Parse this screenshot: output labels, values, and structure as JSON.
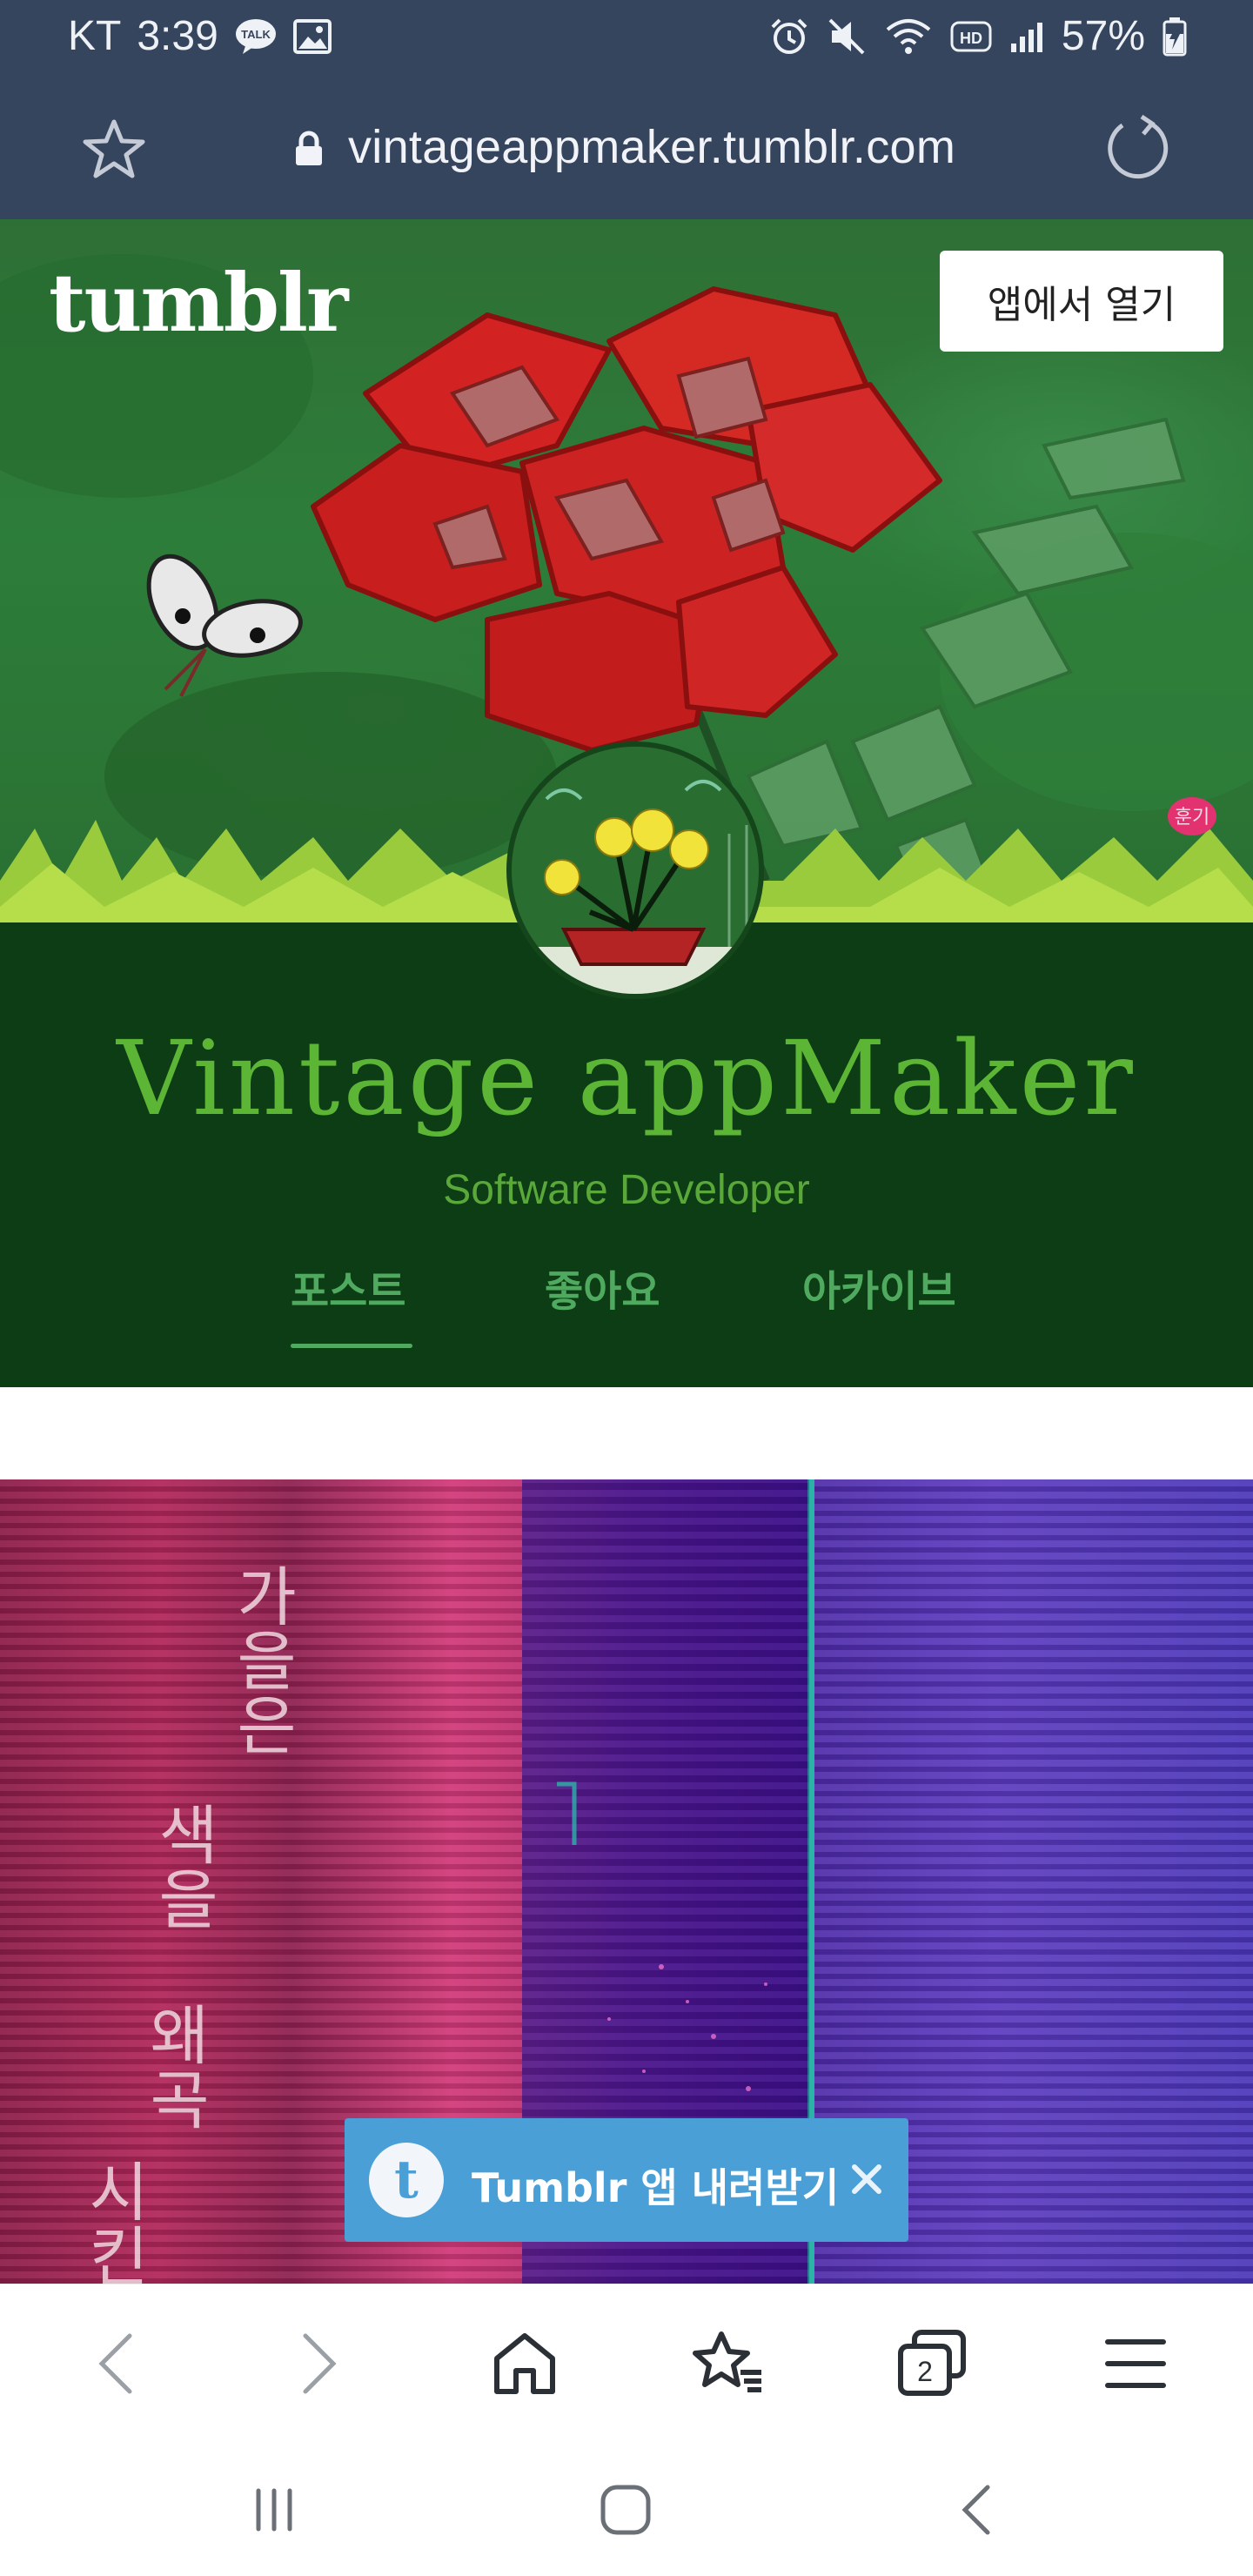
{
  "status_bar": {
    "carrier": "KT",
    "time": "3:39",
    "talk_badge": "TALK",
    "network_badge": "HD",
    "battery": "57%"
  },
  "browser": {
    "url": "vintageappmaker.tumblr.com"
  },
  "header": {
    "logo": "tumblr",
    "open_in_app": "앱에서 열기"
  },
  "blog": {
    "title": "Vintage appMaker",
    "subtitle": "Software Developer",
    "tabs": [
      "포스트",
      "좋아요",
      "아카이브"
    ],
    "active_tab": "포스트"
  },
  "post": {
    "handwritten_text": [
      "가을은",
      "색을",
      "왜곡",
      "시킨다"
    ]
  },
  "toast": {
    "logo": "t",
    "label": "Tumblr 앱 내려받기"
  },
  "toolbar": {
    "tabs_count": "2"
  },
  "colors": {
    "browser_chrome": "#36455e",
    "blog_header_bg": "#0d3d14",
    "blog_title": "#5db536",
    "tab_text": "#4faa60",
    "toast_bg": "#4a9fd6"
  }
}
